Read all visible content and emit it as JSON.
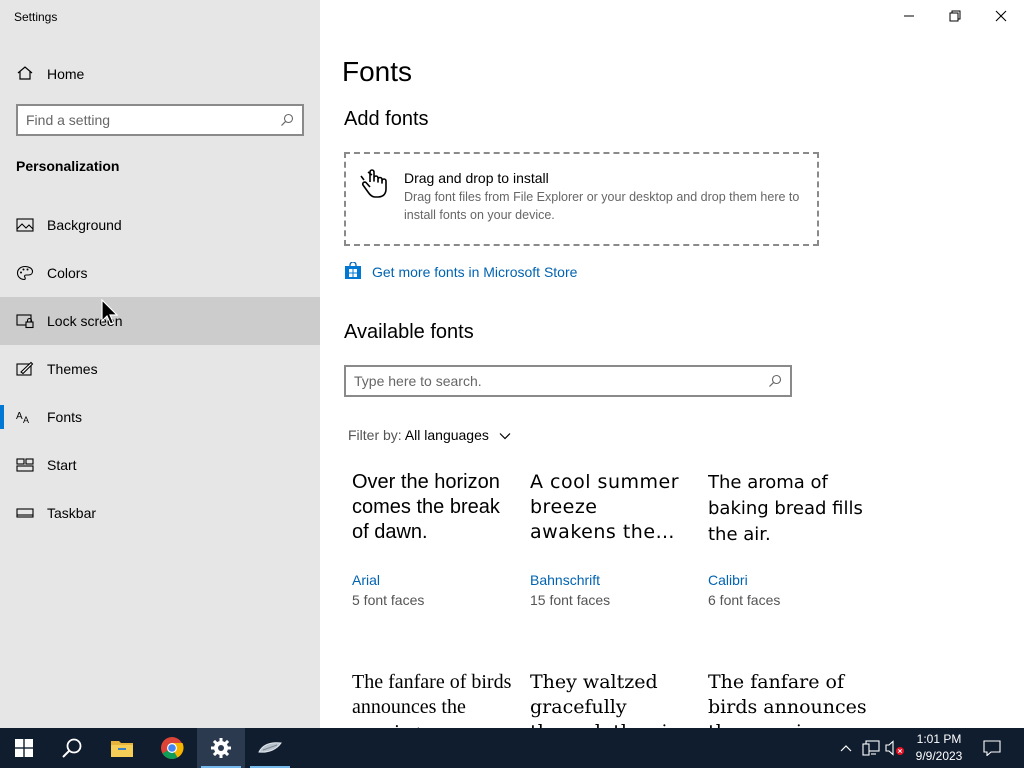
{
  "window": {
    "title": "Settings"
  },
  "sidebar": {
    "home_label": "Home",
    "search_placeholder": "Find a setting",
    "section": "Personalization",
    "items": [
      {
        "label": "Background",
        "icon": "image-icon"
      },
      {
        "label": "Colors",
        "icon": "palette-icon"
      },
      {
        "label": "Lock screen",
        "icon": "lock-screen-icon"
      },
      {
        "label": "Themes",
        "icon": "themes-brush-icon"
      },
      {
        "label": "Fonts",
        "icon": "fonts-icon",
        "selected": true
      },
      {
        "label": "Start",
        "icon": "start-grid-icon"
      },
      {
        "label": "Taskbar",
        "icon": "taskbar-icon"
      }
    ]
  },
  "main": {
    "title": "Fonts",
    "add_fonts_heading": "Add fonts",
    "drop_title": "Drag and drop to install",
    "drop_desc": "Drag font files from File Explorer or your desktop and drop them here to install fonts on your device.",
    "store_link": "Get more fonts in Microsoft Store",
    "available_heading": "Available fonts",
    "font_search_placeholder": "Type here to search.",
    "filter_label": "Filter by:",
    "filter_value": "All languages",
    "fonts": [
      {
        "sample": "Over the horizon comes the break of dawn.",
        "name": "Arial",
        "faces": "5 font faces"
      },
      {
        "sample": "A cool summer breeze awakens the…",
        "name": "Bahnschrift",
        "faces": "15 font faces"
      },
      {
        "sample": "The aroma of baking bread fills the air.",
        "name": "Calibri",
        "faces": "6 font faces"
      },
      {
        "sample": "The fanfare of birds announces the morning.",
        "name": "",
        "faces": ""
      },
      {
        "sample": "They waltzed gracefully through the air.",
        "name": "",
        "faces": ""
      },
      {
        "sample": "The fanfare of birds announces the morning.",
        "name": "",
        "faces": ""
      }
    ]
  },
  "taskbar": {
    "apps": [
      "windows-start-icon",
      "search-icon",
      "file-explorer-icon",
      "chrome-icon",
      "settings-gear-icon",
      "app-icon"
    ],
    "time": "1:01 PM",
    "date": "9/9/2023"
  },
  "colors": {
    "accent": "#0078d4",
    "link": "#0063b1",
    "taskbar": "#101d2f"
  }
}
